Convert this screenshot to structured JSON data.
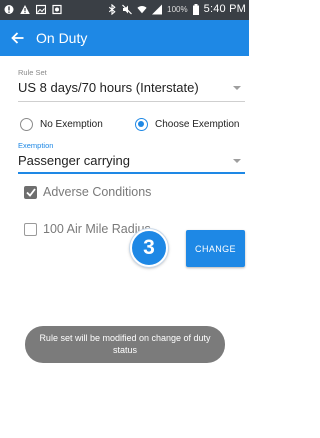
{
  "status_bar": {
    "battery_percent": "100%",
    "time": "5:40 PM"
  },
  "app_bar": {
    "title": "On Duty"
  },
  "rule_set": {
    "label": "Rule Set",
    "value": "US 8 days/70 hours (Interstate)"
  },
  "exemption_options": [
    {
      "label": "No Exemption",
      "selected": false
    },
    {
      "label": "Choose Exemption",
      "selected": true
    }
  ],
  "exemption": {
    "label": "Exemption",
    "value": "Passenger carrying"
  },
  "checkboxes": [
    {
      "label": "Adverse Conditions",
      "checked": true
    },
    {
      "label": "100 Air Mile Radius",
      "checked": false
    }
  ],
  "step_badge": "3",
  "change_button": "CHANGE",
  "toast": "Rule set will be modified on change of duty status",
  "colors": {
    "accent": "#1e88e5",
    "status_bar": "#3a3f45",
    "toast": "#7b7b7b"
  }
}
